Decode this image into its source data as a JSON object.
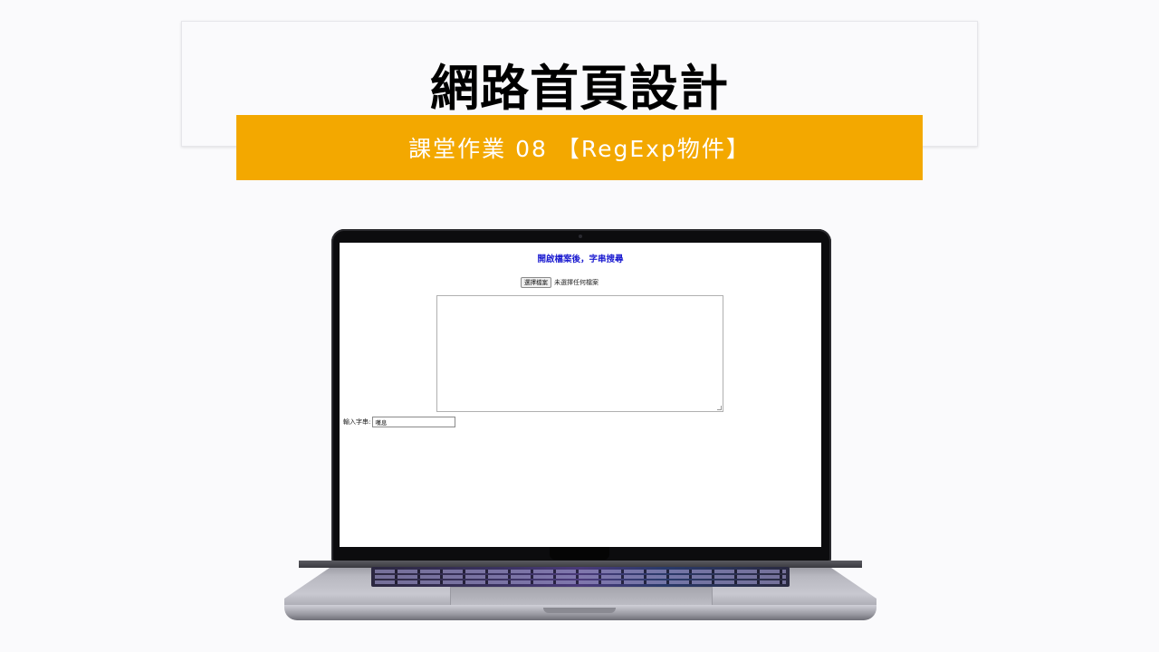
{
  "slide": {
    "title": "網路首頁設計",
    "subtitle": "課堂作業 08 【RegExp物件】"
  },
  "screen": {
    "heading": "開啟檔案後，字串搜尋",
    "file_button_label": "選擇檔案",
    "file_status": "未選擇任何檔案",
    "textarea_value": "",
    "search_label": "輸入字串:",
    "search_value": "嘆息"
  },
  "colors": {
    "banner": "#f3a800",
    "heading": "#1a1ad0",
    "background": "#fafafc"
  },
  "icons": [
    "laptop-device"
  ]
}
